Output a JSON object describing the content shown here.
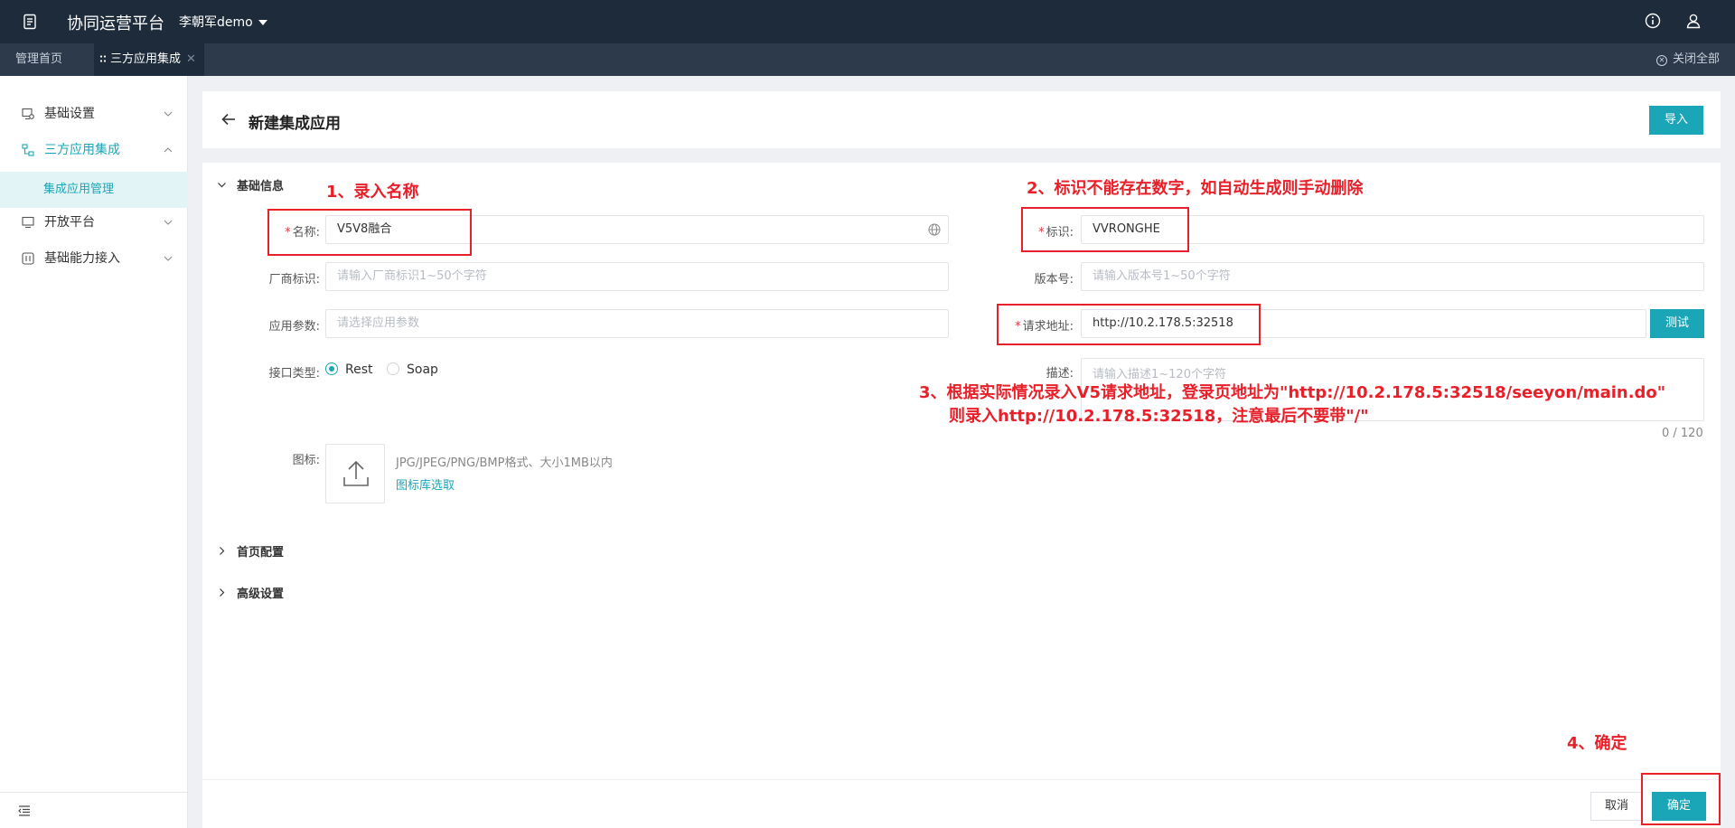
{
  "header": {
    "app_title": "协同运营平台",
    "user": "李朝军demo"
  },
  "tabs": {
    "home": "管理首页",
    "active": "三方应用集成",
    "close_all": "关闭全部"
  },
  "sidebar": {
    "items": [
      {
        "label": "基础设置"
      },
      {
        "label": "三方应用集成"
      },
      {
        "label": "开放平台"
      },
      {
        "label": "基础能力接入"
      }
    ],
    "sub_item": "集成应用管理"
  },
  "page": {
    "title": "新建集成应用",
    "import_label": "导入"
  },
  "form": {
    "section_basic": "基础信息",
    "name_label": "名称:",
    "name_value": "V5V8融合",
    "id_label": "标识:",
    "id_value": "VVRONGHE",
    "vendor_label": "厂商标识:",
    "vendor_placeholder": "请输入厂商标识1~50个字符",
    "version_label": "版本号:",
    "version_placeholder": "请输入版本号1~50个字符",
    "params_label": "应用参数:",
    "params_placeholder": "请选择应用参数",
    "url_label": "请求地址:",
    "url_value": "http://10.2.178.5:32518",
    "test_label": "测试",
    "iface_label": "接口类型:",
    "iface_options": [
      "Rest",
      "Soap"
    ],
    "iface_selected": "Rest",
    "desc_label": "描述:",
    "desc_placeholder": "请输入描述1~120个字符",
    "desc_counter": "0 / 120",
    "icon_label": "图标:",
    "icon_hint": "JPG/JPEG/PNG/BMP格式、大小1MB以内",
    "icon_link": "图标库选取",
    "section_home": "首页配置",
    "section_advanced": "高级设置"
  },
  "footer": {
    "cancel_label": "取消",
    "ok_label": "确定"
  },
  "annotations": {
    "step1": "1、录入名称",
    "step2": "2、标识不能存在数字，如自动生成则手动删除",
    "step3_line1": "3、根据实际情况录入V5请求地址，登录页地址为\"http://10.2.178.5:32518/seeyon/main.do\"",
    "step3_line2": "则录入http://10.2.178.5:32518，注意最后不要带\"/\"",
    "step4": "4、确定"
  },
  "colors": {
    "header_bg": "#1d2b3b",
    "tabbar_bg": "#2d3a4b",
    "accent": "#1aa6b7",
    "annotation": "#e8202a",
    "required": "#e0384a"
  }
}
